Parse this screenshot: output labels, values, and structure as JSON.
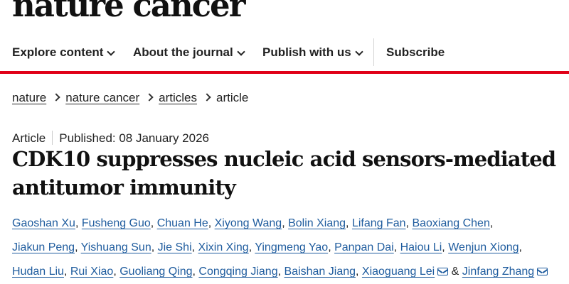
{
  "site": {
    "logo": "nature cancer"
  },
  "nav": {
    "items": [
      {
        "label": "Explore content"
      },
      {
        "label": "About the journal"
      },
      {
        "label": "Publish with us"
      },
      {
        "label": "Subscribe"
      }
    ]
  },
  "breadcrumb": {
    "items": [
      "nature",
      "nature cancer",
      "articles",
      "article"
    ]
  },
  "article": {
    "type": "Article",
    "published": "Published: 08 January 2026",
    "title": "CDK10 suppresses nucleic acid sensors-mediated antitumor immunity",
    "authors": [
      "Gaoshan Xu",
      "Fusheng Guo",
      "Chuan He",
      "Xiyong Wang",
      "Bolin Xiang",
      "Lifang Fan",
      "Baoxiang Chen",
      "Jiakun Peng",
      "Yishuang Sun",
      "Jie Shi",
      "Xixin Xing",
      "Yingmeng Yao",
      "Panpan Dai",
      "Haiou Li",
      "Wenjun Xiong",
      "Hudan Liu",
      "Rui Xiao",
      "Guoliang Qing",
      "Congqing Jiang",
      "Baishan Jiang",
      "Xiaoguang Lei",
      "Jinfang Zhang"
    ],
    "author_joiner": "&"
  },
  "icons": {
    "chevron": "chevron-down-icon",
    "mail": "mail-icon"
  },
  "colors": {
    "accent_red": "#e00017",
    "author_link": "#1f5c9e"
  }
}
